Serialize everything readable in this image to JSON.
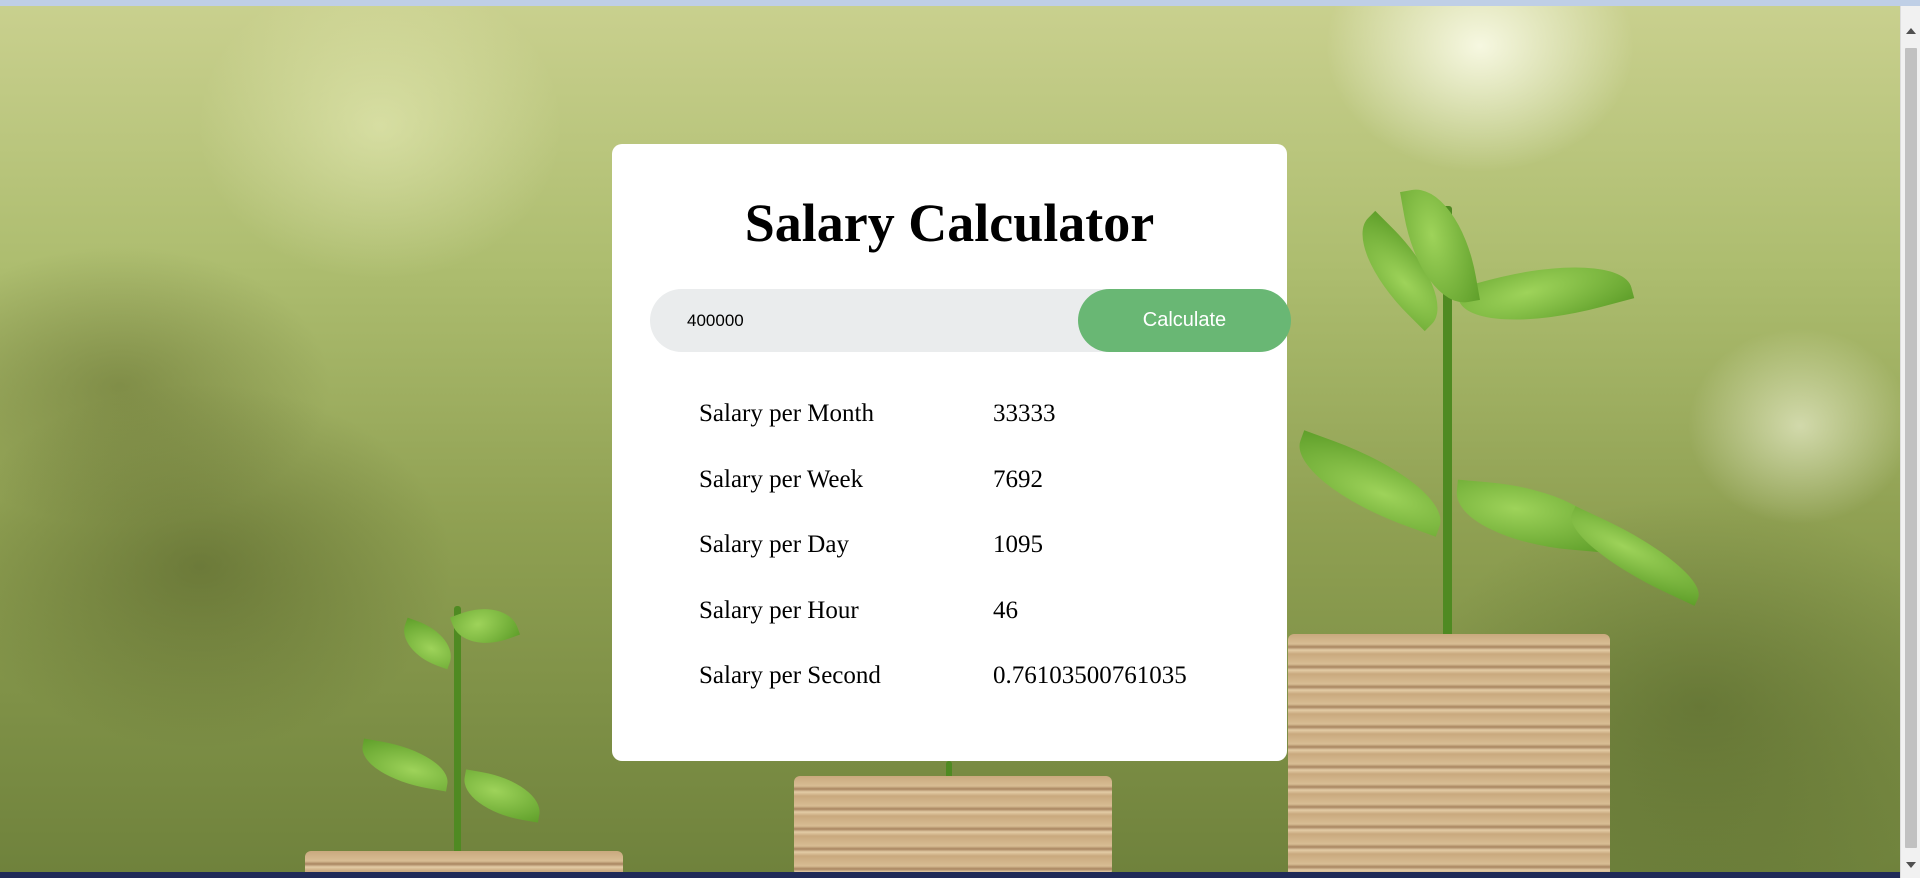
{
  "page": {
    "title": "Salary Calculator"
  },
  "calculator": {
    "input_value": "400000",
    "button_label": "Calculate",
    "results": [
      {
        "label": "Salary per Month",
        "value": "33333"
      },
      {
        "label": "Salary per Week",
        "value": "7692"
      },
      {
        "label": "Salary per Day",
        "value": "1095"
      },
      {
        "label": "Salary per Hour",
        "value": "46"
      },
      {
        "label": "Salary per Second",
        "value": "0.76103500761035"
      }
    ]
  },
  "colors": {
    "button": "#69b774",
    "input_bg": "#eaeced",
    "card": "#ffffff"
  }
}
